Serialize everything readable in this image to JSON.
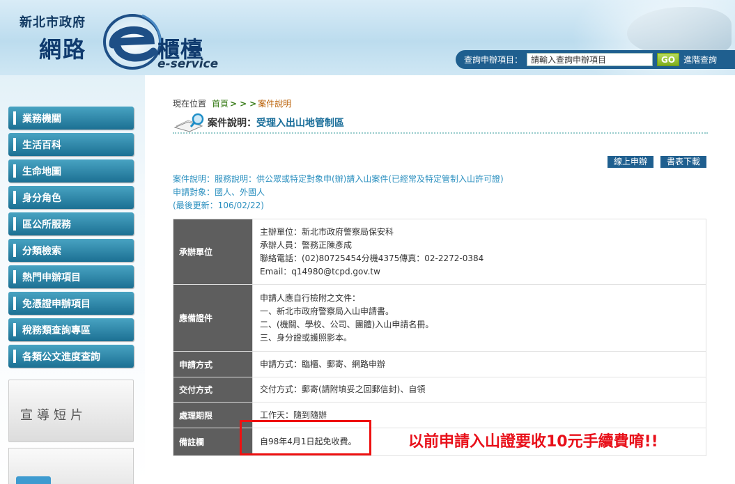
{
  "header": {
    "city": "新北市政府",
    "brand_left": "網路",
    "brand_right": "櫃檯",
    "brand_en": "e-service",
    "search_label": "查詢申辦項目：",
    "search_placeholder": "請輸入查詢申辦項目",
    "go_label": "GO",
    "advanced_label": "進階查詢"
  },
  "sidebar": {
    "items": [
      {
        "label": "業務機關"
      },
      {
        "label": "生活百科"
      },
      {
        "label": "生命地圖"
      },
      {
        "label": "身分角色"
      },
      {
        "label": "區公所服務"
      },
      {
        "label": "分類檢索"
      },
      {
        "label": "熱門申辦項目"
      },
      {
        "label": "免憑證申辦項目"
      },
      {
        "label": "稅務類查詢專區"
      },
      {
        "label": "各類公文進度查詢"
      }
    ],
    "promo_label": "宣導短片"
  },
  "breadcrumb": {
    "prefix": "現在位置",
    "home": "首頁",
    "arrow1": ">",
    "arrow2": ">",
    "arrow3": ">",
    "current": "案件說明"
  },
  "page": {
    "title_prefix": "案件說明：",
    "title": "受理入出山地管制區",
    "online_button": "線上申辦",
    "forms_button": "書表下載",
    "info_lines": [
      "案件說明：服務說明：供公眾或特定對象申(辦)請入山案件(已經常及特定管制入山許可證)",
      "申請對象：國人、外國人",
      "(最後更新：106/02/22)"
    ]
  },
  "table": {
    "rows": [
      {
        "header": "承辦單位",
        "lines": [
          "主辦單位：新北市政府警察局保安科",
          "承辦人員：警務正陳彥成",
          "聯絡電話：(02)80725454分機4375傳真：02-2272-0384",
          "Email：q14980@tcpd.gov.tw"
        ]
      },
      {
        "header": "應備證件",
        "lines": [
          "申請人應自行檢附之文件：",
          "一、新北市政府警察局入山申請書。",
          "二、(機關、學校、公司、團體)入山申請名冊。",
          "三、身分證或護照影本。"
        ]
      },
      {
        "header": "申請方式",
        "lines": [
          "申請方式：臨櫃、郵寄、網路申辦"
        ]
      },
      {
        "header": "交付方式",
        "lines": [
          "交付方式：郵寄(請附填妥之回郵信封)、自領"
        ]
      },
      {
        "header": "處理期限",
        "lines": [
          "工作天：隨到隨辦"
        ]
      },
      {
        "header": "備註欄",
        "lines": [
          "自98年4月1日起免收費。"
        ]
      }
    ]
  },
  "annotation": "以前申請入山證要收10元手續費唷!!",
  "colors": {
    "menu_blue": "#1c7093",
    "header_bg": "#bcdcee",
    "annotation_red": "#e8101a",
    "table_header": "#5e5e5e"
  }
}
